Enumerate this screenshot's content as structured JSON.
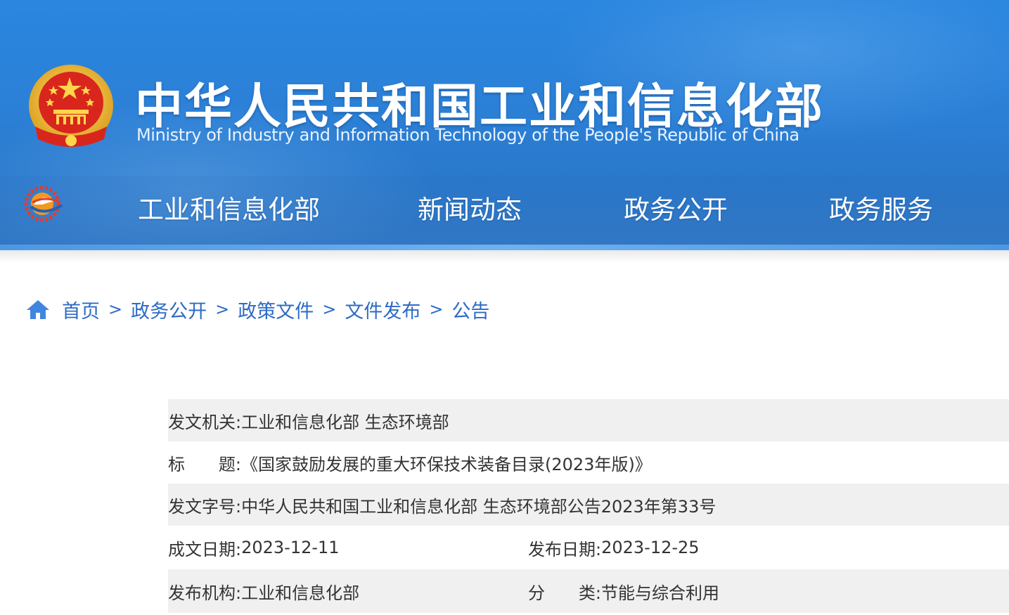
{
  "header": {
    "title_cn": "中华人民共和国工业和信息化部",
    "title_en": "Ministry of Industry and Information Technology of the People's Republic of China",
    "emblem_icon": "national-emblem-icon",
    "nav_logo_icon": "miit-logo-icon",
    "colors": {
      "header_blue": "#2b80d6",
      "text_white": "#ffffff"
    }
  },
  "nav": {
    "items": [
      {
        "label": "工业和信息化部"
      },
      {
        "label": "新闻动态"
      },
      {
        "label": "政务公开"
      },
      {
        "label": "政务服务"
      }
    ]
  },
  "breadcrumb": {
    "home_icon": "home-icon",
    "separator": ">",
    "items": [
      {
        "label": "首页"
      },
      {
        "label": "政务公开"
      },
      {
        "label": "政策文件"
      },
      {
        "label": "文件发布"
      },
      {
        "label": "公告"
      }
    ],
    "link_color": "#2d6bc4"
  },
  "document_info": {
    "issuing_authority": {
      "label": "发文机关:",
      "value": "工业和信息化部 生态环境部"
    },
    "title": {
      "label_a": "标",
      "label_b": "题:",
      "value": "《国家鼓励发展的重大环保技术装备目录(2023年版)》"
    },
    "document_number": {
      "label": "发文字号:",
      "value": "中华人民共和国工业和信息化部 生态环境部公告2023年第33号"
    },
    "written_date": {
      "label": "成文日期:",
      "value": "2023-12-11"
    },
    "publish_date": {
      "label": "发布日期:",
      "value": "2023-12-25"
    },
    "publishing_org": {
      "label": "发布机构:",
      "value": "工业和信息化部"
    },
    "category": {
      "label_a": "分",
      "label_b": "类:",
      "value": "节能与综合利用"
    }
  }
}
